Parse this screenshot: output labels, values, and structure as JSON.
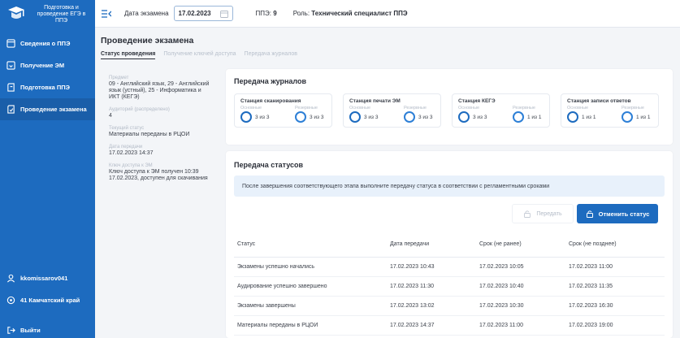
{
  "sidebar": {
    "logo_text": "Подготовка и проведение ЕГЭ в ППЭ",
    "items": [
      {
        "label": "Сведения о ППЭ",
        "icon": "document-icon"
      },
      {
        "label": "Получение ЭМ",
        "icon": "download-icon"
      },
      {
        "label": "Подготовка ППЭ",
        "icon": "prepare-icon"
      },
      {
        "label": "Проведение экзамена",
        "icon": "exam-icon"
      }
    ],
    "user": "kkomissarov041",
    "region": "41 Камчатский край",
    "logout": "Выйти"
  },
  "topbar": {
    "exam_date_label": "Дата экзамена",
    "exam_date": "17.02.2023",
    "ppe_label": "ППЭ:",
    "ppe_value": "9",
    "role_label": "Роль:",
    "role_value": "Технический специалист ППЭ"
  },
  "page": {
    "title": "Проведение экзамена",
    "tabs": [
      "Статус проведения",
      "Получение ключей доступа",
      "Передача журналов"
    ]
  },
  "info": [
    {
      "label": "Предмет",
      "value": "09 - Английский язык, 29 - Английский язык (устный), 25 - Информатика и ИКТ (КЕГЭ)"
    },
    {
      "label": "Аудиторий (распределено)",
      "value": "4"
    },
    {
      "label": "Текущий статус",
      "value": "Материалы переданы в РЦОИ"
    },
    {
      "label": "Дата передачи",
      "value": "17.02.2023 14:37"
    },
    {
      "label": "Ключ доступа к ЭМ",
      "value": "Ключ доступа к ЭМ получен 10:39 17.02.2023, доступен для скачивания"
    }
  ],
  "journals": {
    "title": "Передача журналов",
    "main_label": "Основные",
    "reserve_label": "Резервные",
    "stations": [
      {
        "title": "Станция сканирования",
        "main": "3 из 3",
        "reserve": "3 из 3"
      },
      {
        "title": "Станция печати ЭМ",
        "main": "3 из 3",
        "reserve": "3 из 3"
      },
      {
        "title": "Станция КЕГЭ",
        "main": "3 из 3",
        "reserve": "1 из 1"
      },
      {
        "title": "Станция записи ответов",
        "main": "1 из 1",
        "reserve": "1 из 1"
      }
    ]
  },
  "statuses": {
    "title": "Передача статусов",
    "notice": "После завершения соответствующего этапа выполните передачу статуса в соответствии с регламентными сроками",
    "send_button": "Передать",
    "cancel_button": "Отменить статус",
    "columns": [
      "Статус",
      "Дата передачи",
      "Срок (не ранее)",
      "Срок (не позднее)"
    ],
    "rows": [
      [
        "Экзамены успешно начались",
        "17.02.2023 10:43",
        "17.02.2023 10:05",
        "17.02.2023 11:00"
      ],
      [
        "Аудирование успешно завершено",
        "17.02.2023 11:30",
        "17.02.2023 10:40",
        "17.02.2023 11:35"
      ],
      [
        "Экзамены завершены",
        "17.02.2023 13:02",
        "17.02.2023 10:30",
        "17.02.2023 16:30"
      ],
      [
        "Материалы переданы в РЦОИ",
        "17.02.2023 14:37",
        "17.02.2023 11:00",
        "17.02.2023 19:00"
      ]
    ]
  },
  "colors": {
    "primary": "#1d6bbf",
    "notice_bg": "#e8f1fb"
  }
}
